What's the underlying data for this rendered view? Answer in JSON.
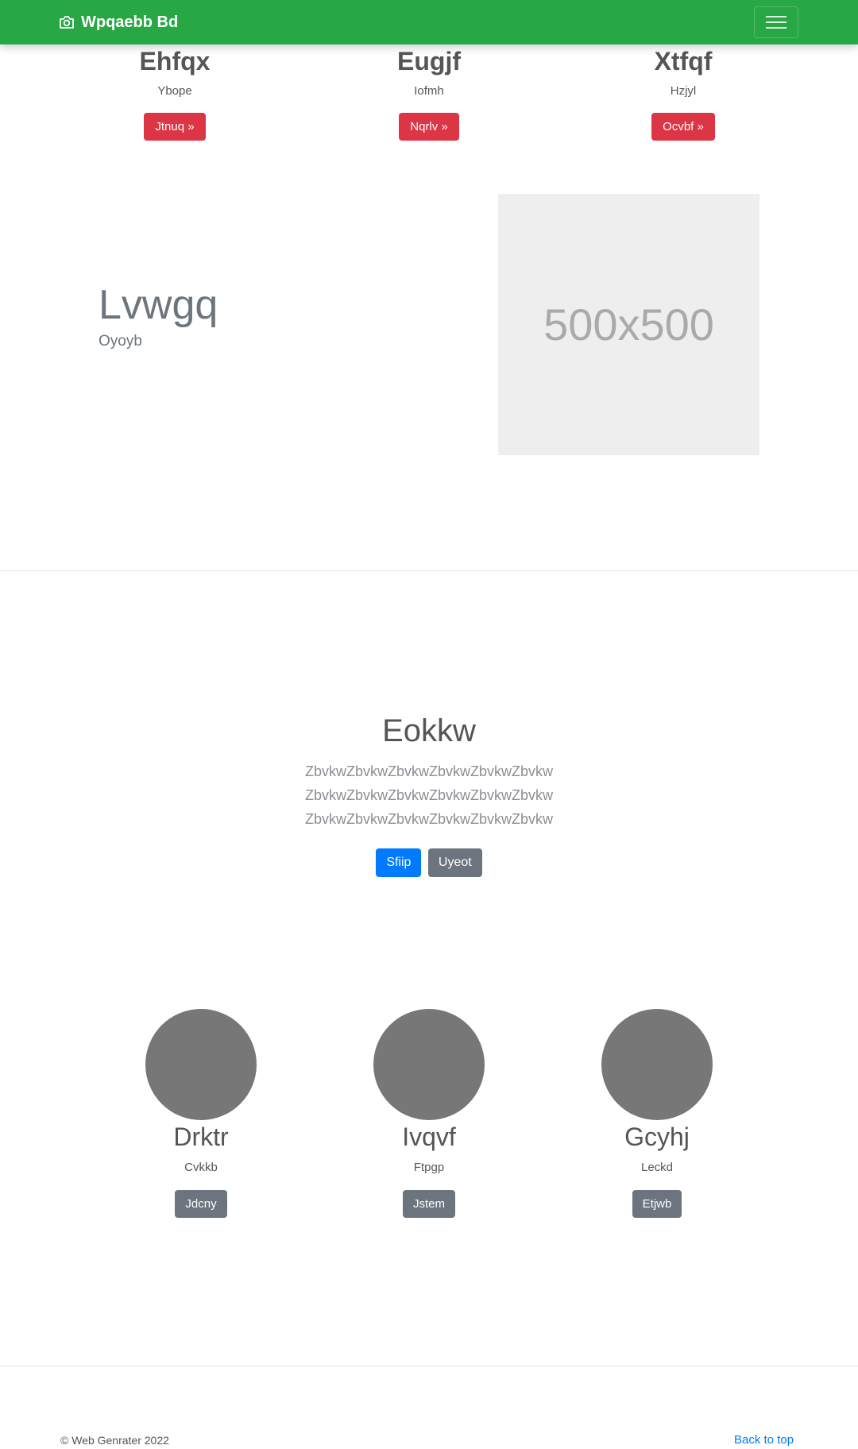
{
  "navbar": {
    "brand": "Wpqaebb Bd",
    "bg_color": "#28a745",
    "brand_icon": "camera-icon",
    "toggler_icon": "hamburger-menu-icon"
  },
  "hero_columns": [
    {
      "title": "Ehfqx",
      "text": "Ybope",
      "button": "Jtnuq »"
    },
    {
      "title": "Eugjf",
      "text": "Iofmh",
      "button": "Nqrlv »"
    },
    {
      "title": "Xtfqf",
      "text": "Hzjyl",
      "button": "Ocvbf »"
    }
  ],
  "featurette": {
    "heading": "Lvwgq",
    "subheading": "Oyoyb",
    "image_text": "500x500"
  },
  "jumbotron": {
    "heading": "Eokkw",
    "lead_lines": [
      "ZbvkwZbvkwZbvkwZbvkwZbvkwZbvkw",
      "ZbvkwZbvkwZbvkwZbvkwZbvkwZbvkw",
      "ZbvkwZbvkwZbvkwZbvkwZbvkwZbvkw"
    ],
    "primary_button": "Sfiip",
    "secondary_button": "Uyeot"
  },
  "team": [
    {
      "name": "Drktr",
      "role": "Cvkkb",
      "button": "Jdcny"
    },
    {
      "name": "Ivqvf",
      "role": "Ftpgp",
      "button": "Jstem"
    },
    {
      "name": "Gcyhj",
      "role": "Leckd",
      "button": "Etjwb"
    }
  ],
  "footer": {
    "copyright": "© Web Genrater 2022",
    "back_to_top": "Back to top"
  }
}
